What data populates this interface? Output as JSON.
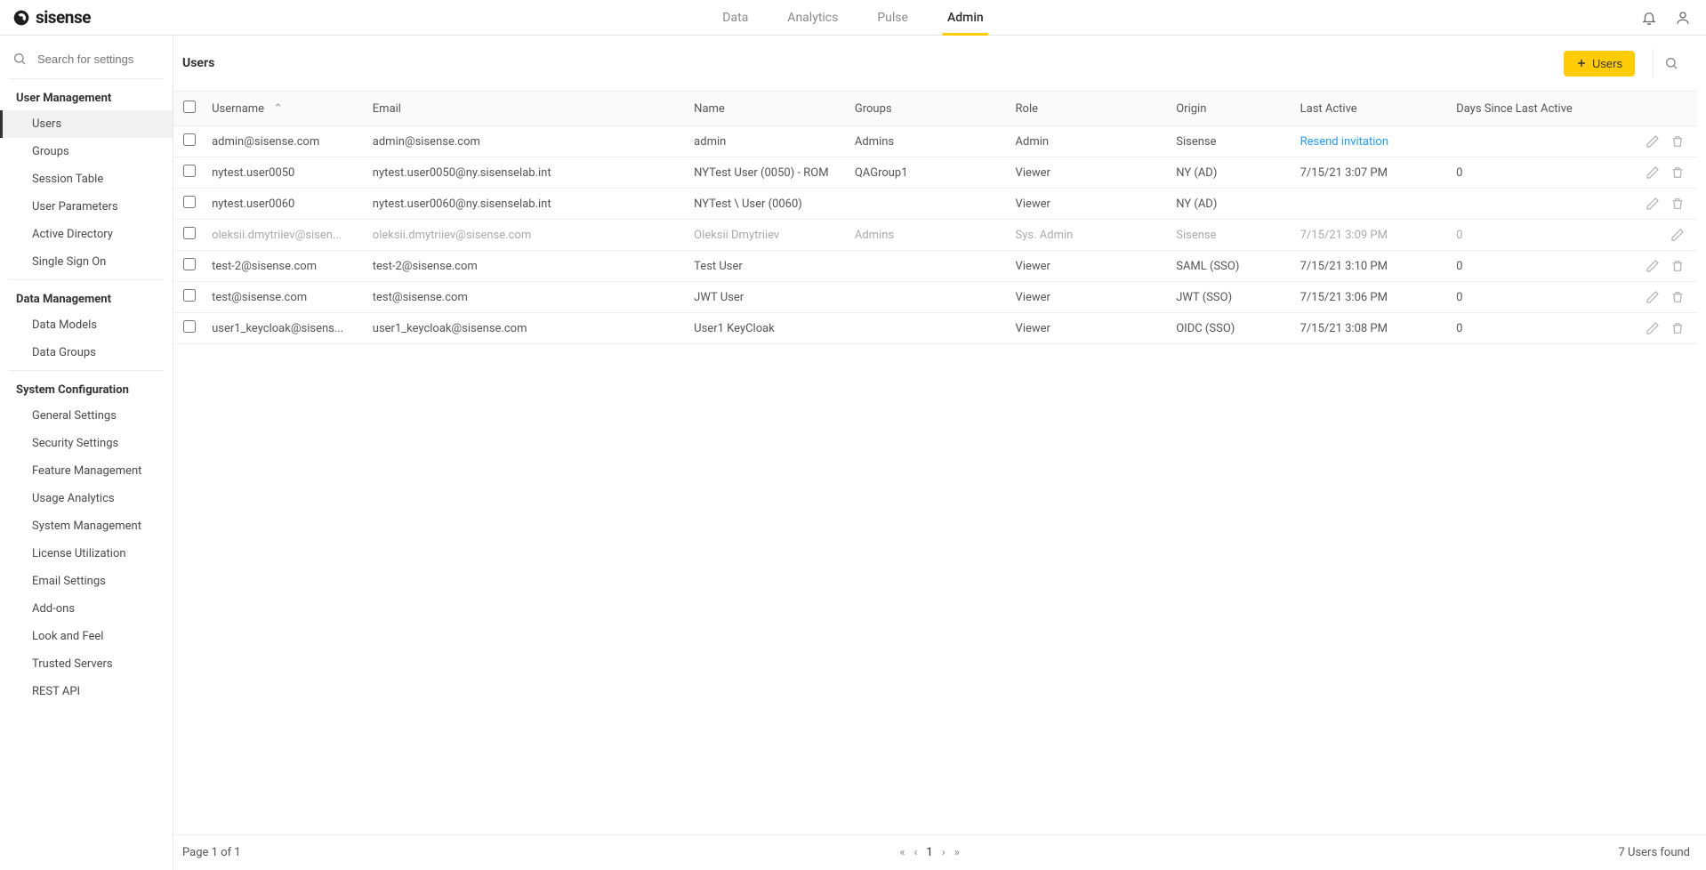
{
  "brand": "sisense",
  "topnav": [
    "Data",
    "Analytics",
    "Pulse",
    "Admin"
  ],
  "topnav_active": "Admin",
  "sidebar": {
    "search_placeholder": "Search for settings",
    "sections": [
      {
        "title": "User Management",
        "items": [
          "Users",
          "Groups",
          "Session Table",
          "User Parameters",
          "Active Directory",
          "Single Sign On"
        ],
        "active": "Users"
      },
      {
        "title": "Data Management",
        "items": [
          "Data Models",
          "Data Groups"
        ]
      },
      {
        "title": "System Configuration",
        "items": [
          "General Settings",
          "Security Settings",
          "Feature Management",
          "Usage Analytics",
          "System Management",
          "License Utilization",
          "Email Settings",
          "Add-ons",
          "Look and Feel",
          "Trusted Servers",
          "REST API"
        ]
      }
    ]
  },
  "page": {
    "title": "Users",
    "add_button": "Users"
  },
  "columns": [
    "Username",
    "Email",
    "Name",
    "Groups",
    "Role",
    "Origin",
    "Last Active",
    "Days Since Last Active"
  ],
  "rows": [
    {
      "username": "admin@sisense.com",
      "email": "admin@sisense.com",
      "name": "admin",
      "groups": "Admins",
      "role": "Admin",
      "origin": "Sisense",
      "last_active": "Resend invitation",
      "last_active_is_link": true,
      "days": "",
      "deletable": true
    },
    {
      "username": "nytest.user0050",
      "email": "nytest.user0050@ny.sisenselab.int",
      "name": "NYTest User (0050) - ROM",
      "groups": "QAGroup1",
      "role": "Viewer",
      "origin": "NY (AD)",
      "last_active": "7/15/21 3:07 PM",
      "days": "0",
      "deletable": true
    },
    {
      "username": "nytest.user0060",
      "email": "nytest.user0060@ny.sisenselab.int",
      "name": "NYTest \\ User (0060)",
      "groups": "",
      "role": "Viewer",
      "origin": "NY (AD)",
      "last_active": "",
      "days": "",
      "deletable": true
    },
    {
      "username": "oleksii.dmytriiev@sisen...",
      "email": "oleksii.dmytriiev@sisense.com",
      "name": "Oleksii Dmytriiev",
      "groups": "Admins",
      "role": "Sys. Admin",
      "origin": "Sisense",
      "last_active": "7/15/21 3:09 PM",
      "days": "0",
      "dim": true,
      "deletable": false
    },
    {
      "username": "test-2@sisense.com",
      "email": "test-2@sisense.com",
      "name": "Test User",
      "groups": "",
      "role": "Viewer",
      "origin": "SAML (SSO)",
      "last_active": "7/15/21 3:10 PM",
      "days": "0",
      "deletable": true
    },
    {
      "username": "test@sisense.com",
      "email": "test@sisense.com",
      "name": "JWT User",
      "groups": "",
      "role": "Viewer",
      "origin": "JWT (SSO)",
      "last_active": "7/15/21 3:06 PM",
      "days": "0",
      "deletable": true
    },
    {
      "username": "user1_keycloak@sisens...",
      "email": "user1_keycloak@sisense.com",
      "name": "User1 KeyCloak",
      "groups": "",
      "role": "Viewer",
      "origin": "OIDC (SSO)",
      "last_active": "7/15/21 3:08 PM",
      "days": "0",
      "deletable": true
    }
  ],
  "footer": {
    "page_info": "Page 1 of 1",
    "current_page": "1",
    "result_text": "7 Users found"
  }
}
